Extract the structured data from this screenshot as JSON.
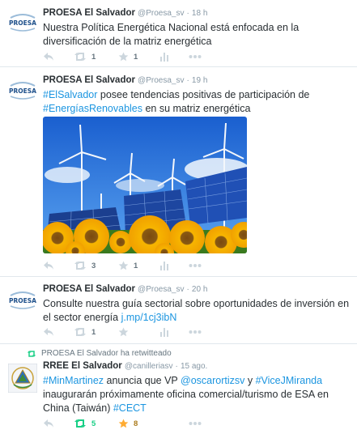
{
  "tweets": [
    {
      "fullname": "PROESA El Salvador",
      "username": "@Proesa_sv",
      "dot": "·",
      "time": "18 h",
      "avatar_text": "PROESA",
      "text": "Nuestra Política Energética Nacional está enfocada en la diversificación de la matriz energética",
      "retweets": "1",
      "favorites": "1"
    },
    {
      "fullname": "PROESA El Salvador",
      "username": "@Proesa_sv",
      "dot": "·",
      "time": "19 h",
      "avatar_text": "PROESA",
      "text_parts": [
        "#ElSalvador",
        " posee tendencias positivas de participación de ",
        "#EnergíasRenovables",
        " en su matriz energética"
      ],
      "retweets": "3",
      "favorites": "1"
    },
    {
      "fullname": "PROESA El Salvador",
      "username": "@Proesa_sv",
      "dot": "·",
      "time": "20 h",
      "avatar_text": "PROESA",
      "text_parts": [
        "Consulte nuestra guía sectorial sobre oportunidades de inversión en el sector energía ",
        "j.mp/1cj3ibN"
      ],
      "retweets": "1",
      "favorites": ""
    },
    {
      "retweet_context": "PROESA El Salvador ha retwitteado",
      "fullname": "RREE El Salvador",
      "username": "@canilleriasv",
      "dot": "·",
      "time": "15 ago.",
      "text_parts": [
        "#MinMartinez",
        " anuncia que VP ",
        "@oscarortizsv",
        " y ",
        "#ViceJMiranda",
        " inaugurarán próximamente oficina comercial/turismo de ESA en China (Taiwán) ",
        "#CECT"
      ],
      "retweets": "5",
      "favorites": "8"
    }
  ],
  "colors": {
    "link": "#1b95e0",
    "retweet_active": "#19cf86",
    "favorite_active": "#ffac33",
    "action_gray": "#ccd6dd"
  }
}
